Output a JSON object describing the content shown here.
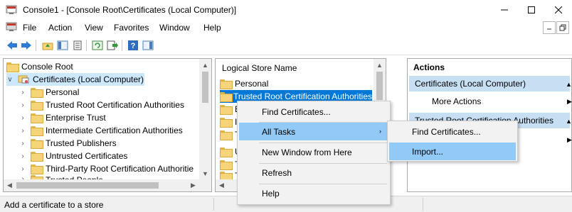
{
  "window": {
    "title": "Console1 - [Console Root\\Certificates (Local Computer)]",
    "minimize": "—",
    "maximize": "☐",
    "close": "✕"
  },
  "menubar": {
    "items": [
      "File",
      "Action",
      "View",
      "Favorites",
      "Window",
      "Help"
    ],
    "mdi_min": "–",
    "mdi_restore": "\u0001"
  },
  "toolbar": {
    "icons": [
      "back-arrow-icon",
      "forward-arrow-icon",
      "up-folder-icon",
      "show-hide-tree-icon",
      "properties-icon",
      "refresh-icon",
      "export-list-icon",
      "help-icon",
      "action-pane-icon"
    ]
  },
  "tree": {
    "root": "Console Root",
    "snapin": "Certificates (Local Computer)",
    "items": [
      "Personal",
      "Trusted Root Certification Authorities",
      "Enterprise Trust",
      "Intermediate Certification Authorities",
      "Trusted Publishers",
      "Untrusted Certificates",
      "Third-Party Root Certification Authoritie",
      "Trusted People"
    ]
  },
  "list": {
    "column_header": "Logical Store Name",
    "rows": [
      "Personal",
      "Trusted Root Certification Authorities",
      "E",
      "I",
      "T",
      "U",
      "T",
      "T"
    ]
  },
  "actions": {
    "header": "Actions",
    "section1": "Certificates (Local Computer)",
    "section1_item": "More Actions",
    "section2": "Trusted Root Certification Authorities"
  },
  "context_menu": {
    "items": [
      "Find Certificates...",
      "All Tasks",
      "New Window from Here",
      "Refresh",
      "Help"
    ]
  },
  "submenu": {
    "items": [
      "Find Certificates...",
      "Import..."
    ]
  },
  "status": {
    "text": "Add a certificate to a store"
  },
  "colors": {
    "selection": "#0078d7",
    "menu_hot": "#91c9f7",
    "actions_section": "#c7dff3",
    "tree_selected": "#cce8ff"
  }
}
